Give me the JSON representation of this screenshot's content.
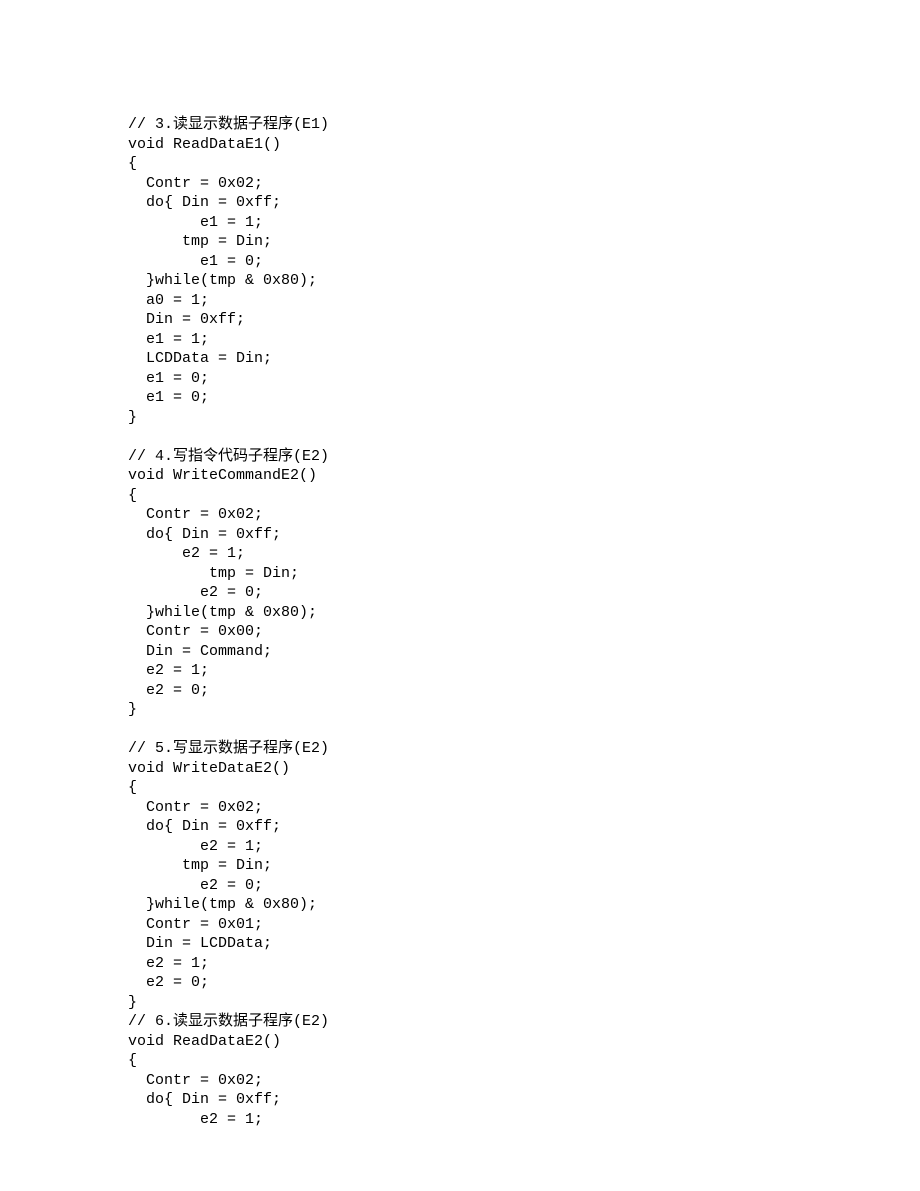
{
  "code": "// 3.读显示数据子程序(E1)\nvoid ReadDataE1()\n{\n  Contr = 0x02;\n  do{ Din = 0xff;\n        e1 = 1;\n      tmp = Din;\n        e1 = 0;\n  }while(tmp & 0x80);\n  a0 = 1;\n  Din = 0xff;\n  e1 = 1;\n  LCDData = Din;\n  e1 = 0;\n  e1 = 0;\n}\n\n// 4.写指令代码子程序(E2)\nvoid WriteCommandE2()\n{\n  Contr = 0x02;\n  do{ Din = 0xff;\n      e2 = 1;\n         tmp = Din;\n        e2 = 0;\n  }while(tmp & 0x80);\n  Contr = 0x00;\n  Din = Command;\n  e2 = 1;\n  e2 = 0;\n}\n\n// 5.写显示数据子程序(E2)\nvoid WriteDataE2()\n{\n  Contr = 0x02;\n  do{ Din = 0xff;\n        e2 = 1;\n      tmp = Din;\n        e2 = 0;\n  }while(tmp & 0x80);\n  Contr = 0x01;\n  Din = LCDData;\n  e2 = 1;\n  e2 = 0;\n}\n// 6.读显示数据子程序(E2)\nvoid ReadDataE2()\n{\n  Contr = 0x02;\n  do{ Din = 0xff;\n        e2 = 1;"
}
